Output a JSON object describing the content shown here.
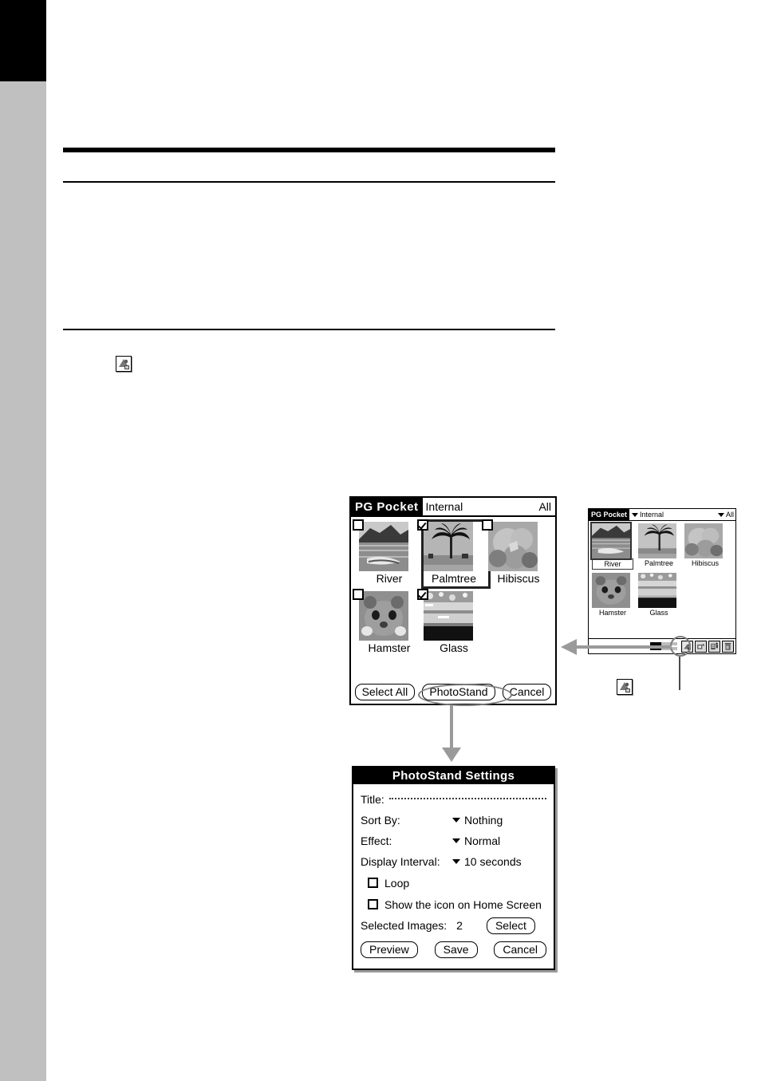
{
  "page": {
    "left_black_block": true,
    "left_gray_band_color": "#c0c0c0"
  },
  "body_icon": {
    "name": "photostand-icon"
  },
  "large_screen": {
    "app_name": "PG Pocket",
    "category_left": "Internal",
    "category_right": "All",
    "thumbnails": [
      {
        "label": "River",
        "checked": false,
        "selected": false,
        "image": "river-photo"
      },
      {
        "label": "Palmtree",
        "checked": true,
        "selected": true,
        "image": "palmtree-photo"
      },
      {
        "label": "Hibiscus",
        "checked": false,
        "selected": false,
        "image": "hibiscus-photo"
      },
      {
        "label": "Hamster",
        "checked": false,
        "selected": false,
        "image": "hamster-photo"
      },
      {
        "label": "Glass",
        "checked": true,
        "selected": false,
        "image": "glass-photo"
      }
    ],
    "buttons": {
      "select_all": "Select All",
      "photostand": "PhotoStand",
      "cancel": "Cancel"
    },
    "highlighted_button": "PhotoStand"
  },
  "small_screen": {
    "app_name": "PG Pocket",
    "category_left": "Internal",
    "category_right": "All",
    "thumbnails": [
      {
        "label": "River",
        "selected": true,
        "image": "river-photo"
      },
      {
        "label": "Palmtree",
        "selected": false,
        "image": "palmtree-photo"
      },
      {
        "label": "Hibiscus",
        "selected": false,
        "image": "hibiscus-photo"
      },
      {
        "label": "Hamster",
        "selected": false,
        "image": "hamster-photo"
      },
      {
        "label": "Glass",
        "selected": false,
        "image": "glass-photo"
      }
    ],
    "toolbar_icons": [
      {
        "name": "photostand-toolbar-icon",
        "highlighted": true
      },
      {
        "name": "beam-icon",
        "highlighted": false
      },
      {
        "name": "export-icon",
        "highlighted": false
      },
      {
        "name": "trash-icon",
        "highlighted": false
      }
    ]
  },
  "settings_dialog": {
    "title": "PhotoStand Settings",
    "fields": {
      "title_label": "Title:",
      "title_value": "",
      "sort_by_label": "Sort By:",
      "sort_by_value": "Nothing",
      "effect_label": "Effect:",
      "effect_value": "Normal",
      "interval_label": "Display Interval:",
      "interval_value": "10 seconds",
      "loop_label": "Loop",
      "loop_checked": false,
      "home_icon_label": "Show the icon on Home Screen",
      "home_icon_checked": false,
      "selected_images_label": "Selected Images:",
      "selected_images_count": "2",
      "select_button": "Select"
    },
    "buttons": {
      "preview": "Preview",
      "save": "Save",
      "cancel": "Cancel"
    }
  }
}
